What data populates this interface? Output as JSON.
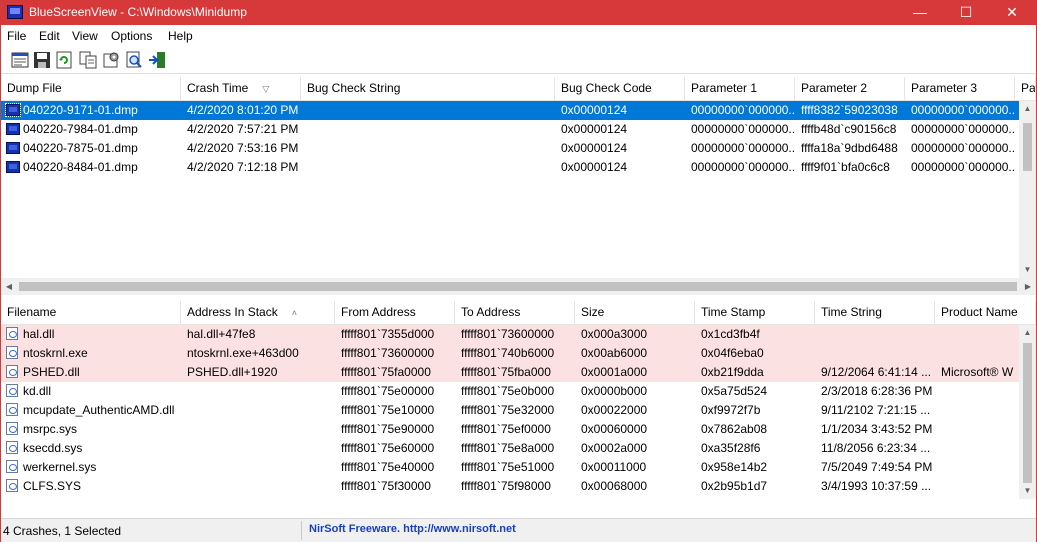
{
  "window": {
    "title": "BlueScreenView  -  C:\\Windows\\Minidump",
    "controls": {
      "minimize": "—",
      "maximize": "☐",
      "close": "✕"
    },
    "accent_color": "#d7393b"
  },
  "menu": [
    "File",
    "Edit",
    "View",
    "Options",
    "Help"
  ],
  "toolbar": [
    "properties-icon",
    "save-icon",
    "refresh-icon",
    "copy-icon",
    "options-icon",
    "find-icon",
    "exit-icon"
  ],
  "crash_list": {
    "columns": [
      "Dump File",
      "Crash Time",
      "Bug Check String",
      "Bug Check Code",
      "Parameter 1",
      "Parameter 2",
      "Parameter 3",
      "Pa"
    ],
    "sorted_column": "Crash Time",
    "rows": [
      {
        "dump_file": "040220-9171-01.dmp",
        "crash_time": "4/2/2020 8:01:20 PM",
        "bug_check_string": "",
        "bug_check_code": "0x00000124",
        "param1": "00000000`000000...",
        "param2": "ffff8382`59023038",
        "param3": "00000000`000000...",
        "selected": true
      },
      {
        "dump_file": "040220-7984-01.dmp",
        "crash_time": "4/2/2020 7:57:21 PM",
        "bug_check_string": "",
        "bug_check_code": "0x00000124",
        "param1": "00000000`000000...",
        "param2": "ffffb48d`c90156c8",
        "param3": "00000000`000000...",
        "selected": false
      },
      {
        "dump_file": "040220-7875-01.dmp",
        "crash_time": "4/2/2020 7:53:16 PM",
        "bug_check_string": "",
        "bug_check_code": "0x00000124",
        "param1": "00000000`000000...",
        "param2": "ffffa18a`9dbd6488",
        "param3": "00000000`000000...",
        "selected": false
      },
      {
        "dump_file": "040220-8484-01.dmp",
        "crash_time": "4/2/2020 7:12:18 PM",
        "bug_check_string": "",
        "bug_check_code": "0x00000124",
        "param1": "00000000`000000...",
        "param2": "ffff9f01`bfa0c6c8",
        "param3": "00000000`000000...",
        "selected": false
      }
    ]
  },
  "driver_list": {
    "columns": [
      "Filename",
      "Address In Stack",
      "From Address",
      "To Address",
      "Size",
      "Time Stamp",
      "Time String",
      "Product Name"
    ],
    "sorted_column": "Address In Stack",
    "rows": [
      {
        "filename": "hal.dll",
        "address_in_stack": "hal.dll+47fe8",
        "from": "fffff801`7355d000",
        "to": "fffff801`73600000",
        "size": "0x000a3000",
        "time_stamp": "0x1cd3fb4f",
        "time_string": "",
        "product_name": "",
        "highlight": true
      },
      {
        "filename": "ntoskrnl.exe",
        "address_in_stack": "ntoskrnl.exe+463d00",
        "from": "fffff801`73600000",
        "to": "fffff801`740b6000",
        "size": "0x00ab6000",
        "time_stamp": "0x04f6eba0",
        "time_string": "",
        "product_name": "",
        "highlight": true
      },
      {
        "filename": "PSHED.dll",
        "address_in_stack": "PSHED.dll+1920",
        "from": "fffff801`75fa0000",
        "to": "fffff801`75fba000",
        "size": "0x0001a000",
        "time_stamp": "0xb21f9dda",
        "time_string": "9/12/2064 6:41:14 ...",
        "product_name": "Microsoft® W",
        "highlight": true
      },
      {
        "filename": "kd.dll",
        "address_in_stack": "",
        "from": "fffff801`75e00000",
        "to": "fffff801`75e0b000",
        "size": "0x0000b000",
        "time_stamp": "0x5a75d524",
        "time_string": "2/3/2018 6:28:36 PM",
        "product_name": "",
        "highlight": false
      },
      {
        "filename": "mcupdate_AuthenticAMD.dll",
        "address_in_stack": "",
        "from": "fffff801`75e10000",
        "to": "fffff801`75e32000",
        "size": "0x00022000",
        "time_stamp": "0xf9972f7b",
        "time_string": "9/11/2102 7:21:15 ...",
        "product_name": "",
        "highlight": false
      },
      {
        "filename": "msrpc.sys",
        "address_in_stack": "",
        "from": "fffff801`75e90000",
        "to": "fffff801`75ef0000",
        "size": "0x00060000",
        "time_stamp": "0x7862ab08",
        "time_string": "1/1/2034 3:43:52 PM",
        "product_name": "",
        "highlight": false
      },
      {
        "filename": "ksecdd.sys",
        "address_in_stack": "",
        "from": "fffff801`75e60000",
        "to": "fffff801`75e8a000",
        "size": "0x0002a000",
        "time_stamp": "0xa35f28f6",
        "time_string": "11/8/2056 6:23:34 ...",
        "product_name": "",
        "highlight": false
      },
      {
        "filename": "werkernel.sys",
        "address_in_stack": "",
        "from": "fffff801`75e40000",
        "to": "fffff801`75e51000",
        "size": "0x00011000",
        "time_stamp": "0x958e14b2",
        "time_string": "7/5/2049 7:49:54 PM",
        "product_name": "",
        "highlight": false
      },
      {
        "filename": "CLFS.SYS",
        "address_in_stack": "",
        "from": "fffff801`75f30000",
        "to": "fffff801`75f98000",
        "size": "0x00068000",
        "time_stamp": "0x2b95b1d7",
        "time_string": "3/4/1993 10:37:59 ...",
        "product_name": "",
        "highlight": false
      }
    ]
  },
  "statusbar": {
    "summary": "4 Crashes, 1 Selected",
    "credit": "NirSoft Freeware.  http://www.nirsoft.net"
  },
  "colors": {
    "selection": "#0078d7",
    "highlight_row": "#fbe1e1",
    "link": "#1a3fbf"
  }
}
